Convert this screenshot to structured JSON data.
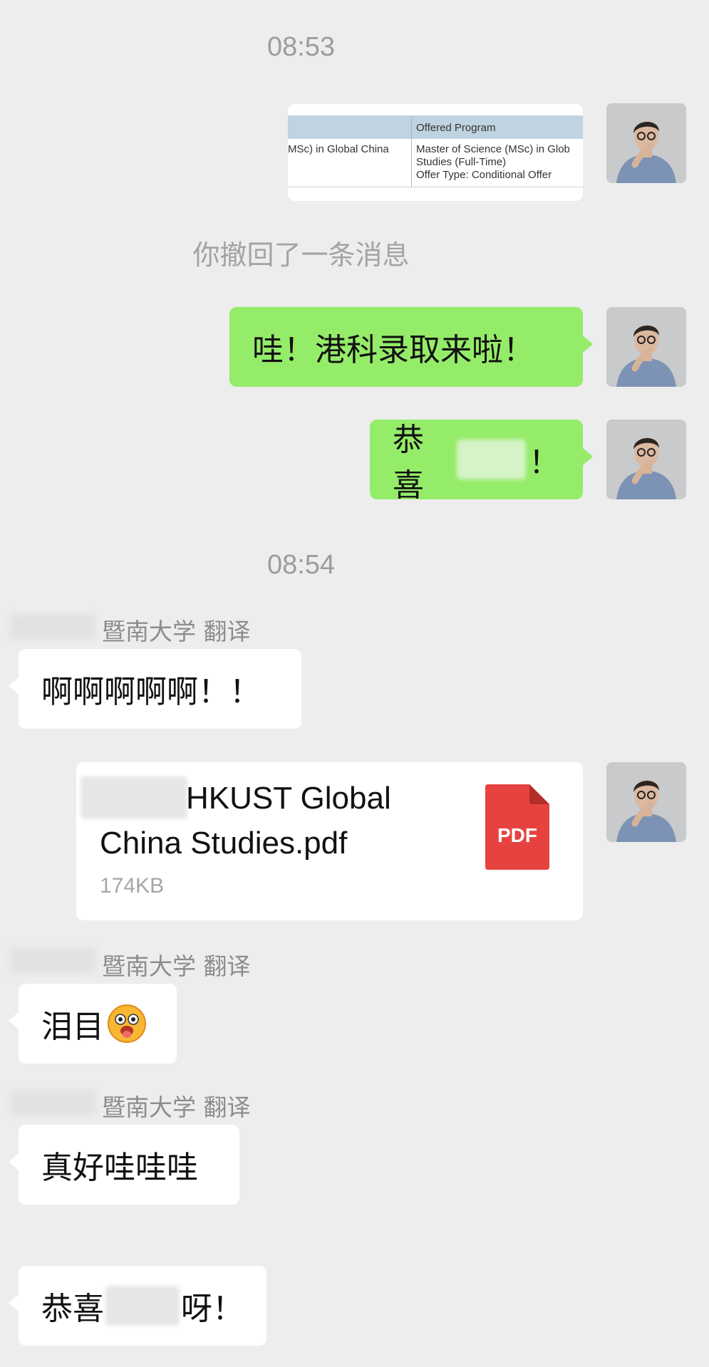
{
  "chat": {
    "time_1": "08:53",
    "offer_image": {
      "header": "Offered Program",
      "left_cell": "MSc) in Global China",
      "right_line_1": "Master of Science (MSc) in Glob",
      "right_line_2": "Studies (Full-Time)",
      "right_line_3": "Offer Type: Conditional Offer"
    },
    "recall_notice": "你撤回了一条消息",
    "msg_1": "哇！港科录取来啦！",
    "msg_2_prefix": "恭喜",
    "msg_2_suffix": "！",
    "time_2": "08:54",
    "sender_label": "暨南大学 翻译",
    "reply_1": "啊啊啊啊啊！！",
    "file": {
      "name_line_1": "HKUST Global",
      "name_line_2": "China Studies.pdf",
      "size": "174KB",
      "icon_label": "PDF"
    },
    "reply_2": "泪目",
    "reply_3": "真好哇哇哇",
    "reply_4_prefix": "恭喜",
    "reply_4_suffix": "呀！"
  },
  "colors": {
    "background": "#ededed",
    "self_bubble": "#95ec69",
    "other_bubble": "#ffffff",
    "pdf_red": "#e64340"
  }
}
